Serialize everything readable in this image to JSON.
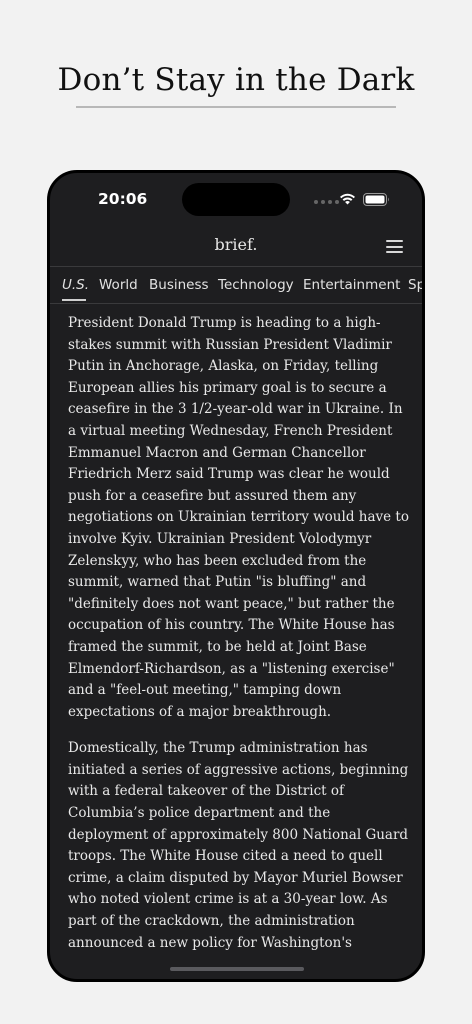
{
  "headline": "Don’t Stay in the Dark",
  "status_bar": {
    "time": "20:06",
    "wifi_icon": "wifi-icon",
    "battery_icon": "battery-icon"
  },
  "app": {
    "title": "brief.",
    "menu_icon": "hamburger-menu-icon"
  },
  "tabs": [
    {
      "label": "U.S.",
      "active": true
    },
    {
      "label": "World",
      "active": false
    },
    {
      "label": "Business",
      "active": false
    },
    {
      "label": "Technology",
      "active": false
    },
    {
      "label": "Entertainment",
      "active": false
    },
    {
      "label": "Sp",
      "active": false
    }
  ],
  "article": {
    "paragraphs": [
      "President Donald Trump is heading to a high-stakes summit with Russian President Vladimir Putin in Anchorage, Alaska, on Friday, telling European allies his primary goal is to secure a ceasefire in the 3 1/2-year-old war in Ukraine. In a virtual meeting Wednesday, French President Emmanuel Macron and German Chancellor Friedrich Merz said Trump was clear he would push for a ceasefire but assured them any negotiations on Ukrainian territory would have to involve Kyiv. Ukrainian President Volodymyr Zelenskyy, who has been excluded from the summit, warned that Putin \"is bluffing\" and \"definitely does not want peace,\" but rather the occupation of his country. The White House has framed the summit, to be held at Joint Base Elmendorf-Richardson, as a \"listening exercise\" and a \"feel-out meeting,\" tamping down expectations of a major breakthrough.",
      "Domestically, the Trump administration has initiated a series of aggressive actions, beginning with a federal takeover of the District of Columbia’s police department and the deployment of approximately 800 National Guard troops. The White House cited a need to quell crime, a claim disputed by Mayor Muriel Bowser who noted violent crime is at a 30-year low. As part of the crackdown, the administration announced a new policy for Washington's"
    ]
  },
  "colors": {
    "page_background": "#f2f2f2",
    "phone_background": "#1e1e20",
    "text": "#e8e8e8"
  }
}
